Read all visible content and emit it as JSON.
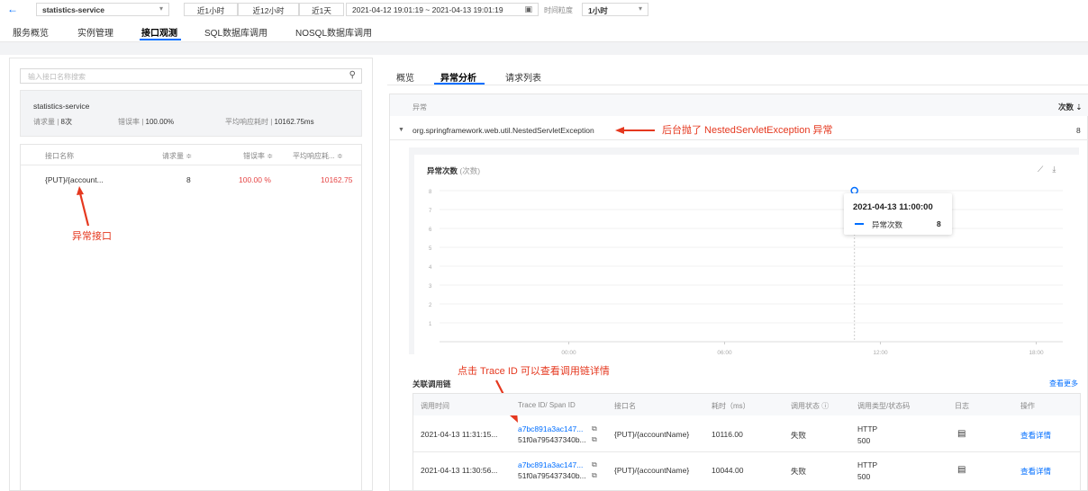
{
  "toolbar": {
    "back_icon": "back-arrow-icon",
    "service": "statistics-service",
    "quick_ranges": [
      "近1小时",
      "近12小时",
      "近1天"
    ],
    "time_range": "2021-04-12 19:01:19 ~ 2021-04-13 19:01:19",
    "granularity_label": "时间粒度",
    "granularity": "1小时"
  },
  "nav_tabs": [
    "服务概览",
    "实例管理",
    "接口观测",
    "SQL数据库调用",
    "NOSQL数据库调用"
  ],
  "left": {
    "search_placeholder": "输入接口名称搜索",
    "service_card": {
      "name": "statistics-service",
      "req_label": "请求量 | ",
      "req_value": "8次",
      "err_label": "错误率 | ",
      "err_value": "100.00%",
      "avg_label": "平均响应耗时 | ",
      "avg_value": "10162.75ms"
    },
    "table": {
      "headers": [
        "接口名称",
        "请求量 ≑",
        "错误率 ≑",
        "平均响应耗... ≑"
      ],
      "rows": [
        [
          "{PUT}/{account...",
          "8",
          "100.00 %",
          "10162.75"
        ]
      ]
    },
    "annotation": "异常接口"
  },
  "right": {
    "tabs": [
      "概览",
      "异常分析",
      "请求列表"
    ],
    "exception_table": {
      "headers": [
        "异常",
        "次数 ⇣"
      ],
      "row": {
        "name": "org.springframework.web.util.NestedServletException",
        "count": "8"
      }
    },
    "annotation_exception": "后台抛了 NestedServletException 异常",
    "chart_header": {
      "title": "异常次数",
      "unit": "(次数)"
    },
    "tooltip": {
      "time": "2021-04-13 11:00:00",
      "label": "异常次数",
      "value": "8"
    },
    "annotation_trace": "点击 Trace ID 可以查看调用链详情",
    "linked": {
      "title": "关联调用链",
      "more": "查看更多",
      "headers": [
        "调用时间",
        "Trace ID/ Span ID",
        "接口名",
        "耗时（ms）",
        "调用状态 ⓘ",
        "调用类型/状态码",
        "日志",
        "操作"
      ],
      "rows": [
        {
          "time": "2021-04-13 11:31:15...",
          "trace": "a7bc891a3ac147...",
          "span": "51f0a795437340b...",
          "api": "{PUT}/{accountName}",
          "cost": "10116.00",
          "status": "失败",
          "type": "HTTP",
          "code": "500",
          "op": "查看详情"
        },
        {
          "time": "2021-04-13 11:30:56...",
          "trace": "a7bc891a3ac147...",
          "span": "51f0a795437340b...",
          "api": "{PUT}/{accountName}",
          "cost": "10044.00",
          "status": "失败",
          "type": "HTTP",
          "code": "500",
          "op": "查看详情"
        }
      ]
    }
  },
  "chart_data": {
    "type": "line",
    "title": "异常次数",
    "ylabel": "(次数)",
    "x_ticks": [
      "00:00",
      "06:00",
      "12:00",
      "18:00"
    ],
    "y_ticks": [
      "1",
      "2",
      "3",
      "4",
      "5",
      "6",
      "7",
      "8"
    ],
    "ylim": [
      0,
      8
    ],
    "series": [
      {
        "name": "异常次数",
        "points": [
          {
            "x": "2021-04-13 11:00:00",
            "y": 8
          }
        ]
      }
    ],
    "colors": {
      "series": "#006eff",
      "grid": "#f0f0f0"
    }
  }
}
